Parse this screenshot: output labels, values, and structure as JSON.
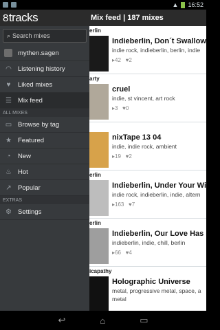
{
  "status": {
    "time": "16:52"
  },
  "app": {
    "logo_text": "tracks",
    "logo_mark": "8"
  },
  "header": {
    "title": "Mix feed  |  187 mixes"
  },
  "drawer": {
    "search_placeholder": "Search mixes",
    "user": "mythen.sagen",
    "items": [
      {
        "label": "Listening history",
        "icon": "headphones-icon"
      },
      {
        "label": "Liked mixes",
        "icon": "heart-icon"
      },
      {
        "label": "Mix feed",
        "icon": "list-icon"
      }
    ],
    "section_all": "ALL MIXES",
    "all_items": [
      {
        "label": "Browse by tag",
        "icon": "tag-icon"
      },
      {
        "label": "Featured",
        "icon": "star-icon"
      },
      {
        "label": "New",
        "icon": "clock-icon"
      },
      {
        "label": "Hot",
        "icon": "flame-icon"
      },
      {
        "label": "Popular",
        "icon": "trend-icon"
      }
    ],
    "section_extras": "EXTRAS",
    "settings": "Settings"
  },
  "feed": [
    {
      "tagline": "erlin",
      "title": "Indieberlin, Don´t Swallow Th",
      "tags": "indie rock, indieberlin, berlin, indie",
      "plays": "42",
      "likes": "2"
    },
    {
      "tagline": "arty",
      "title": "cruel",
      "tags": "indie, st vincent, art rock",
      "plays": "3",
      "likes": "0"
    },
    {
      "tagline": "",
      "title": "nixTape 13 04",
      "tags": "indie, indie rock, ambient",
      "plays": "19",
      "likes": "2"
    },
    {
      "tagline": "erlin",
      "title": "Indieberlin, Under Your Wing",
      "tags": "indie rock, indieberlin, indie, altern",
      "plays": "163",
      "likes": "7"
    },
    {
      "tagline": "erlin",
      "title": "Indieberlin, Our Love Has No",
      "tags": "indieberlin, indie, chill, berlin",
      "plays": "66",
      "likes": "4"
    },
    {
      "tagline": "icapathy",
      "title": "Holographic Universe",
      "tags": "metal, progressive metal, space, a",
      "tags2": "metal",
      "plays": "",
      "likes": ""
    }
  ],
  "colors": {
    "drawer_bg": "#373a3d",
    "header_bg": "#2b2b2b",
    "feed_bg": "#ffffff"
  }
}
